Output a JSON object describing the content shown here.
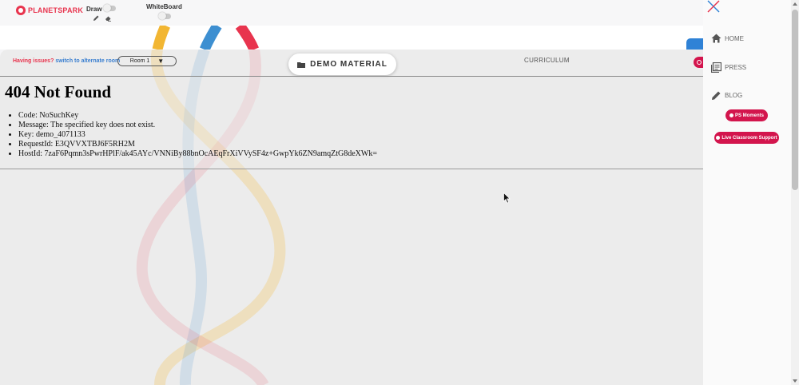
{
  "brand": {
    "name": "PLANETSPARK",
    "color": "#e8344e"
  },
  "toolbar": {
    "draw_label": "Draw",
    "whiteboard_label": "WhiteBoard",
    "draw_enabled": false,
    "whiteboard_enabled": false,
    "icons": [
      "pencil-icon",
      "eraser-icon"
    ]
  },
  "session": {
    "issue_text": "Having issues?",
    "switch_link": "switch to alternate room",
    "room_selected": "Room 1",
    "demo_button": "DEMO MATERIAL",
    "curriculum_tab": "CURRICULUM"
  },
  "error": {
    "title": "404 Not Found",
    "items": [
      "Code: NoSuchKey",
      "Message: The specified key does not exist.",
      "Key: demo_4071133",
      "RequestId: E3QVVXTBJ6F5RH2M",
      "HostId: 7zaF6Pqmn3sPwrHPlF/ak45AYc/VNNiBy88bnOcAEqFrXiVVySF4z+GwpYk6ZN9amqZtG8deXWk="
    ]
  },
  "sidebar": {
    "nav": [
      {
        "label": "HOME",
        "icon": "home-icon"
      },
      {
        "label": "PRESS",
        "icon": "press-icon"
      },
      {
        "label": "BLOG",
        "icon": "edit-icon"
      }
    ],
    "ps_moments": "PS Moments",
    "live_support": "Live Classroom Support"
  },
  "colors": {
    "accent": "#d3154d",
    "link": "#3a7fd0",
    "brand_blue": "#2f82d6",
    "ribbon_yellow": "#f2b632",
    "ribbon_blue": "#3d8fd1",
    "ribbon_red": "#e8344e"
  }
}
